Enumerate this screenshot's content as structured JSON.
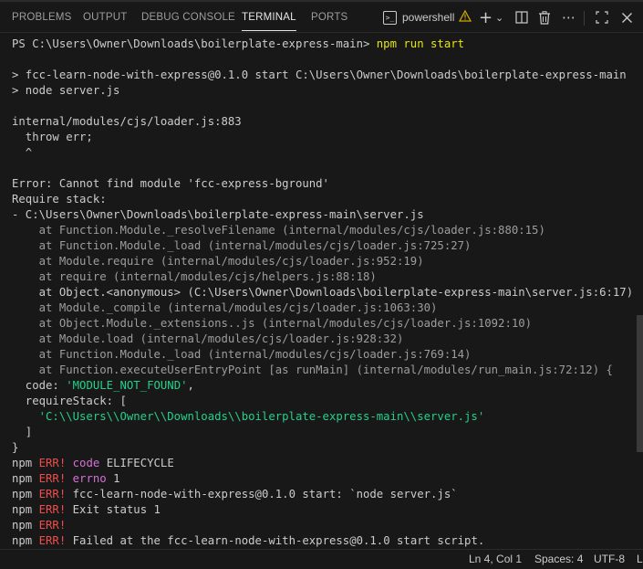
{
  "panel": {
    "tabs": [
      "PROBLEMS",
      "OUTPUT",
      "DEBUG CONSOLE",
      "TERMINAL",
      "PORTS"
    ],
    "active_tab": "TERMINAL",
    "shell_label": "powershell",
    "icons": [
      "terminal-icon",
      "warning-icon",
      "new-terminal-icon",
      "dropdown-icon",
      "split-terminal-icon",
      "trash-icon",
      "maximize-icon",
      "close-icon"
    ]
  },
  "terminal": {
    "prompt": "PS C:\\Users\\Owner\\Downloads\\boilerplate-express-main> ",
    "command": "npm run start",
    "lines": [
      "> fcc-learn-node-with-express@0.1.0 start C:\\Users\\Owner\\Downloads\\boilerplate-express-main",
      "> node server.js",
      "internal/modules/cjs/loader.js:883",
      "  throw err;",
      "  ^",
      "Error: Cannot find module 'fcc-express-bground'",
      "Require stack:",
      "- C:\\Users\\Owner\\Downloads\\boilerplate-express-main\\server.js",
      "    at Function.Module._resolveFilename (internal/modules/cjs/loader.js:880:15)",
      "    at Function.Module._load (internal/modules/cjs/loader.js:725:27)",
      "    at Module.require (internal/modules/cjs/loader.js:952:19)",
      "    at require (internal/modules/cjs/helpers.js:88:18)",
      "    at Object.<anonymous> (C:\\Users\\Owner\\Downloads\\boilerplate-express-main\\server.js:6:17)",
      "    at Module._compile (internal/modules/cjs/loader.js:1063:30)",
      "    at Object.Module._extensions..js (internal/modules/cjs/loader.js:1092:10)",
      "    at Module.load (internal/modules/cjs/loader.js:928:32)",
      "    at Function.Module._load (internal/modules/cjs/loader.js:769:14)",
      "    at Function.executeUserEntryPoint [as runMain] (internal/modules/run_main.js:72:12) {",
      "  code: ",
      "'MODULE_NOT_FOUND'",
      ",",
      "  requireStack: [",
      "    'C:\\\\Users\\\\Owner\\\\Downloads\\\\boilerplate-express-main\\\\server.js'",
      "  ]",
      "}",
      "npm",
      "ERR!",
      "code",
      "ELIFECYCLE",
      "errno",
      "1",
      "fcc-learn-node-with-express@0.1.0 start: `node server.js`",
      "Exit status 1",
      "Failed at the fcc-learn-node-with-express@0.1.0 start script."
    ]
  },
  "status_bar": {
    "position": "Ln 4, Col 1",
    "spaces": "Spaces: 4",
    "encoding": "UTF-8",
    "eol": "L"
  },
  "colors": {
    "background": "#181818",
    "text": "#cccccc",
    "dim": "#9d9d9d",
    "prompt_command": "#e5e510",
    "string": "#23d18b",
    "error": "#f14c4c",
    "keyword": "#d670d6"
  }
}
